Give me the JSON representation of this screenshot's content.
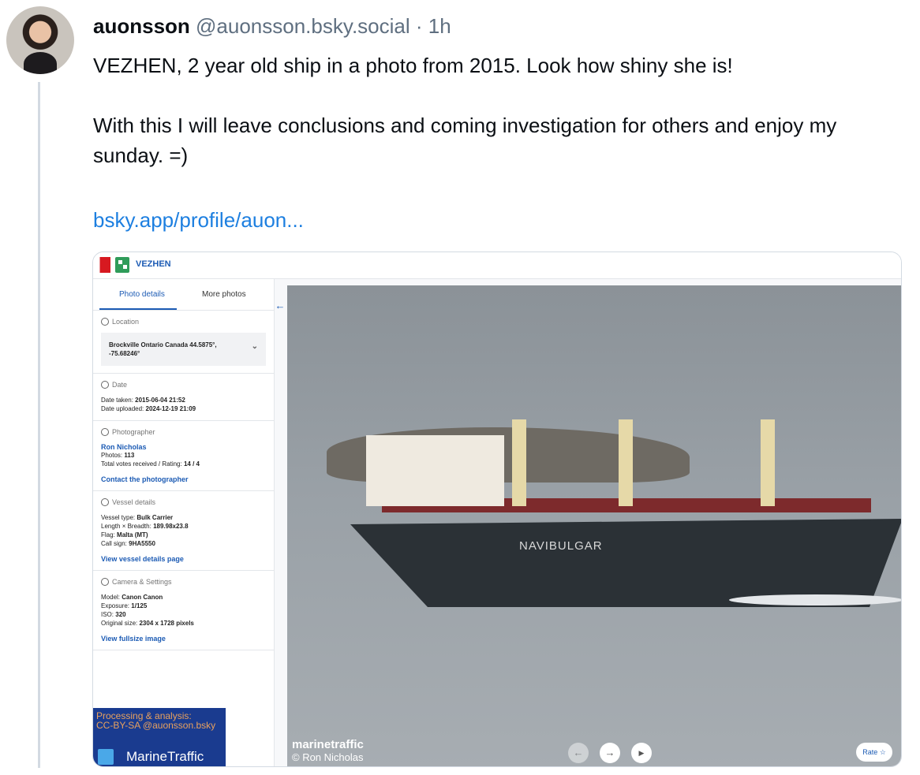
{
  "post": {
    "author_name": "auonsson",
    "author_handle": "@auonsson.bsky.social",
    "time": "· 1h",
    "text_p1": "VEZHEN, 2 year old ship in a photo from 2015. Look how shiny she is!",
    "text_p2": "With this I will leave conclusions and coming investigation for others and enjoy my sunday. =)",
    "link": "bsky.app/profile/auon..."
  },
  "embed": {
    "vessel_name": "VEZHEN",
    "tabs": [
      "Photo details",
      "More photos"
    ],
    "location": {
      "title": "Location",
      "value": "Brockville Ontario Canada 44.5875°, -75.68246°"
    },
    "date": {
      "title": "Date",
      "taken_label": "Date taken:",
      "taken_value": "2015-06-04 21:52",
      "uploaded_label": "Date uploaded:",
      "uploaded_value": "2024-12-19 21:09"
    },
    "photographer": {
      "title": "Photographer",
      "name": "Ron Nicholas",
      "photos_label": "Photos:",
      "photos_value": "113",
      "votes_label": "Total votes received / Rating:",
      "votes_value": "14 / 4",
      "contact": "Contact the photographer"
    },
    "vessel": {
      "title": "Vessel details",
      "type_label": "Vessel type:",
      "type_value": "Bulk Carrier",
      "dims_label": "Length × Breadth:",
      "dims_value": "189.98x23.8",
      "flag_label": "Flag:",
      "flag_value": "Malta (MT)",
      "callsign_label": "Call sign:",
      "callsign_value": "9HA5550",
      "link": "View vessel details page"
    },
    "camera": {
      "title": "Camera & Settings",
      "model_label": "Model:",
      "model_value": "Canon Canon",
      "exposure_label": "Exposure:",
      "exposure_value": "1/125",
      "iso_label": "ISO:",
      "iso_value": "320",
      "size_label": "Original size:",
      "size_value": "2304 x 1728 pixels",
      "link": "View fullsize image"
    },
    "overlay": {
      "line1": "Processing & analysis:",
      "line2": "CC-BY-SA @auonsson.bsky",
      "brand": "MarineTraffic"
    },
    "photo": {
      "hull_text": "NAVIBULGAR",
      "brand": "marinetraffic",
      "credit": "© Ron Nicholas",
      "rate": "Rate ☆"
    },
    "icons": {
      "back": "←",
      "prev": "←",
      "next": "→",
      "play": "▶",
      "chevron": "⌄"
    }
  }
}
